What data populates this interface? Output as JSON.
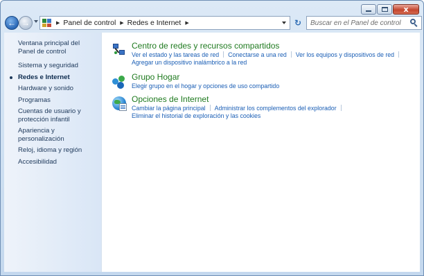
{
  "window": {
    "caption": {
      "minimize": "",
      "maximize": "",
      "close": "x"
    }
  },
  "navigation": {
    "back_glyph": "←",
    "forward_glyph": "→",
    "breadcrumbs": [
      "Panel de control",
      "Redes e Internet"
    ],
    "crumb_separator": "▶",
    "refresh_glyph": "↻",
    "search_placeholder": "Buscar en el Panel de control"
  },
  "sidebar": {
    "home_link": "Ventana principal del Panel de control",
    "items": [
      "Sistema y seguridad",
      "Redes e Internet",
      "Hardware y sonido",
      "Programas",
      "Cuentas de usuario y protección infantil",
      "Apariencia y personalización",
      "Reloj, idioma y región",
      "Accesibilidad"
    ],
    "active_index": 1
  },
  "categories": [
    {
      "icon": "network-center-icon",
      "title": "Centro de redes y recursos compartidos",
      "task_lines": [
        [
          "Ver el estado y las tareas de red",
          "Conectarse a una red",
          "Ver los equipos y dispositivos de red"
        ],
        [
          "Agregar un dispositivo inalámbrico a la red"
        ]
      ]
    },
    {
      "icon": "homegroup-icon",
      "title": "Grupo Hogar",
      "task_lines": [
        [
          "Elegir grupo en el hogar y opciones de uso compartido"
        ]
      ]
    },
    {
      "icon": "internet-options-icon",
      "title": "Opciones de Internet",
      "task_lines": [
        [
          "Cambiar la página principal",
          "Administrar los complementos del explorador"
        ],
        [
          "Eliminar el historial de exploración y las cookies"
        ]
      ]
    }
  ],
  "colors": {
    "category_title": "#1f7a1f",
    "task_link": "#1a5eb5",
    "sidebar_text": "#1e395b"
  }
}
